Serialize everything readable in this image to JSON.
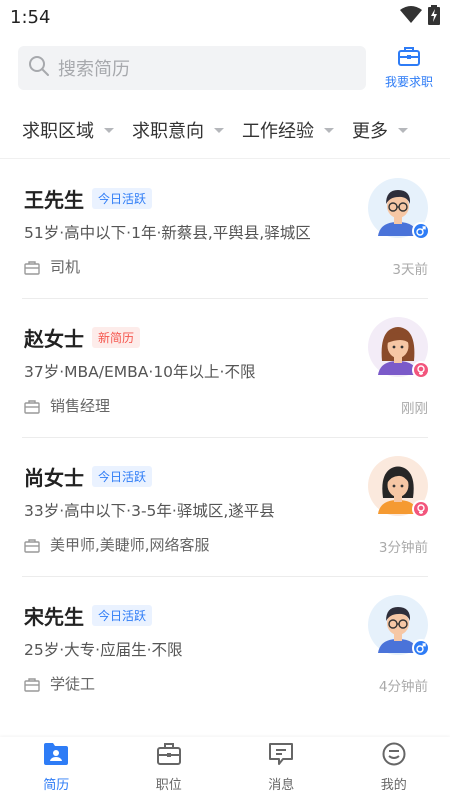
{
  "status_bar": {
    "time": "1:54"
  },
  "search": {
    "placeholder": "搜索简历"
  },
  "job_seek": {
    "label": "我要求职"
  },
  "filters": [
    {
      "label": "求职区域"
    },
    {
      "label": "求职意向"
    },
    {
      "label": "工作经验"
    },
    {
      "label": "更多"
    }
  ],
  "resumes": [
    {
      "name": "王先生",
      "badge": "今日活跃",
      "badge_type": "active",
      "info": "51岁·高中以下·1年·新蔡县,平舆县,驿城区",
      "job": "司机",
      "time": "3天前",
      "gender": "male",
      "avatar": "male-glasses"
    },
    {
      "name": "赵女士",
      "badge": "新简历",
      "badge_type": "new",
      "info": "37岁·MBA/EMBA·10年以上·不限",
      "job": "销售经理",
      "time": "刚刚",
      "gender": "female",
      "avatar": "female-brown-hair"
    },
    {
      "name": "尚女士",
      "badge": "今日活跃",
      "badge_type": "active",
      "info": "33岁·高中以下·3-5年·驿城区,遂平县",
      "job": "美甲师,美睫师,网络客服",
      "time": "3分钟前",
      "gender": "female",
      "avatar": "female-black-hair"
    },
    {
      "name": "宋先生",
      "badge": "今日活跃",
      "badge_type": "active",
      "info": "25岁·大专·应届生·不限",
      "job": "学徒工",
      "time": "4分钟前",
      "gender": "male",
      "avatar": "male-glasses"
    }
  ],
  "bottom_nav": [
    {
      "label": "简历",
      "active": true,
      "icon": "resume-icon"
    },
    {
      "label": "职位",
      "active": false,
      "icon": "briefcase-icon"
    },
    {
      "label": "消息",
      "active": false,
      "icon": "message-icon"
    },
    {
      "label": "我的",
      "active": false,
      "icon": "profile-icon"
    }
  ],
  "colors": {
    "accent": "#2e7cf6",
    "new_badge": "#f5564e",
    "female": "#f2567d"
  }
}
